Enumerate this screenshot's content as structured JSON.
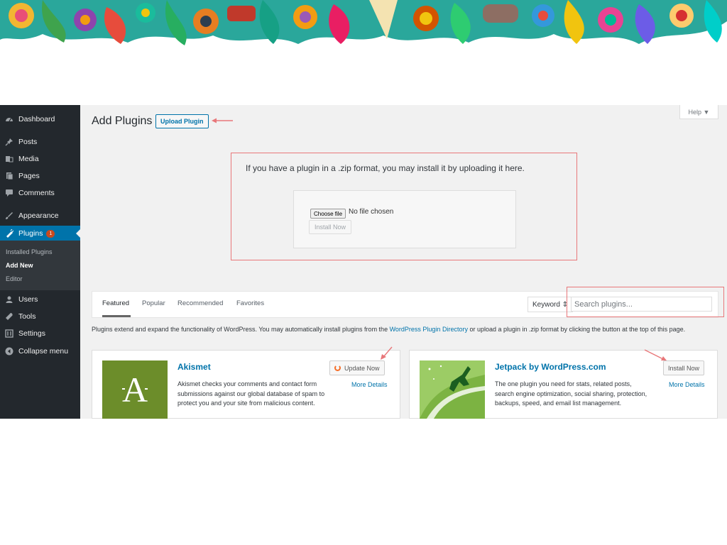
{
  "sidebar": {
    "items": [
      {
        "label": "Dashboard",
        "icon": "dashboard-icon"
      },
      {
        "label": "Posts",
        "icon": "pin-icon"
      },
      {
        "label": "Media",
        "icon": "media-icon"
      },
      {
        "label": "Pages",
        "icon": "pages-icon"
      },
      {
        "label": "Comments",
        "icon": "comment-icon"
      },
      {
        "label": "Appearance",
        "icon": "brush-icon"
      },
      {
        "label": "Plugins",
        "icon": "plugin-icon",
        "badge": "1",
        "active": true
      },
      {
        "label": "Users",
        "icon": "users-icon"
      },
      {
        "label": "Tools",
        "icon": "wrench-icon"
      },
      {
        "label": "Settings",
        "icon": "settings-icon"
      },
      {
        "label": "Collapse menu",
        "icon": "collapse-icon"
      }
    ],
    "submenu": [
      {
        "label": "Installed Plugins"
      },
      {
        "label": "Add New",
        "current": true
      },
      {
        "label": "Editor"
      }
    ]
  },
  "header": {
    "title": "Add Plugins",
    "upload_button": "Upload Plugin",
    "help_tab": "Help ▼"
  },
  "upload": {
    "message": "If you have a plugin in a .zip format, you may install it by uploading it here.",
    "choose_file": "Choose file",
    "no_file": "No file chosen",
    "install_button": "Install Now"
  },
  "filter": {
    "tabs": [
      "Featured",
      "Popular",
      "Recommended",
      "Favorites"
    ],
    "current_tab": "Featured",
    "search_type": "Keyword ⇕",
    "search_placeholder": "Search plugins..."
  },
  "intro": {
    "before_link": "Plugins extend and expand the functionality of WordPress. You may automatically install plugins from the ",
    "link": "WordPress Plugin Directory",
    "after_link": " or upload a plugin in .zip format by clicking the button at the top of this page."
  },
  "plugins": [
    {
      "name": "Akismet",
      "description": "Akismet checks your comments and contact form submissions against our global database of spam to protect you and your site from malicious content.",
      "action": "Update Now",
      "more": "More Details",
      "thumb_letter": "A",
      "thumb_color": "#6c8d2a"
    },
    {
      "name": "Jetpack by WordPress.com",
      "description": "The one plugin you need for stats, related posts, search engine optimization, social sharing, protection, backups, speed, and email list management.",
      "action": "Install Now",
      "more": "More Details",
      "thumb_color": "#9ccc65"
    }
  ],
  "colors": {
    "sidebar": "#23282d",
    "active": "#0073aa",
    "annotation": "#e8777a"
  }
}
